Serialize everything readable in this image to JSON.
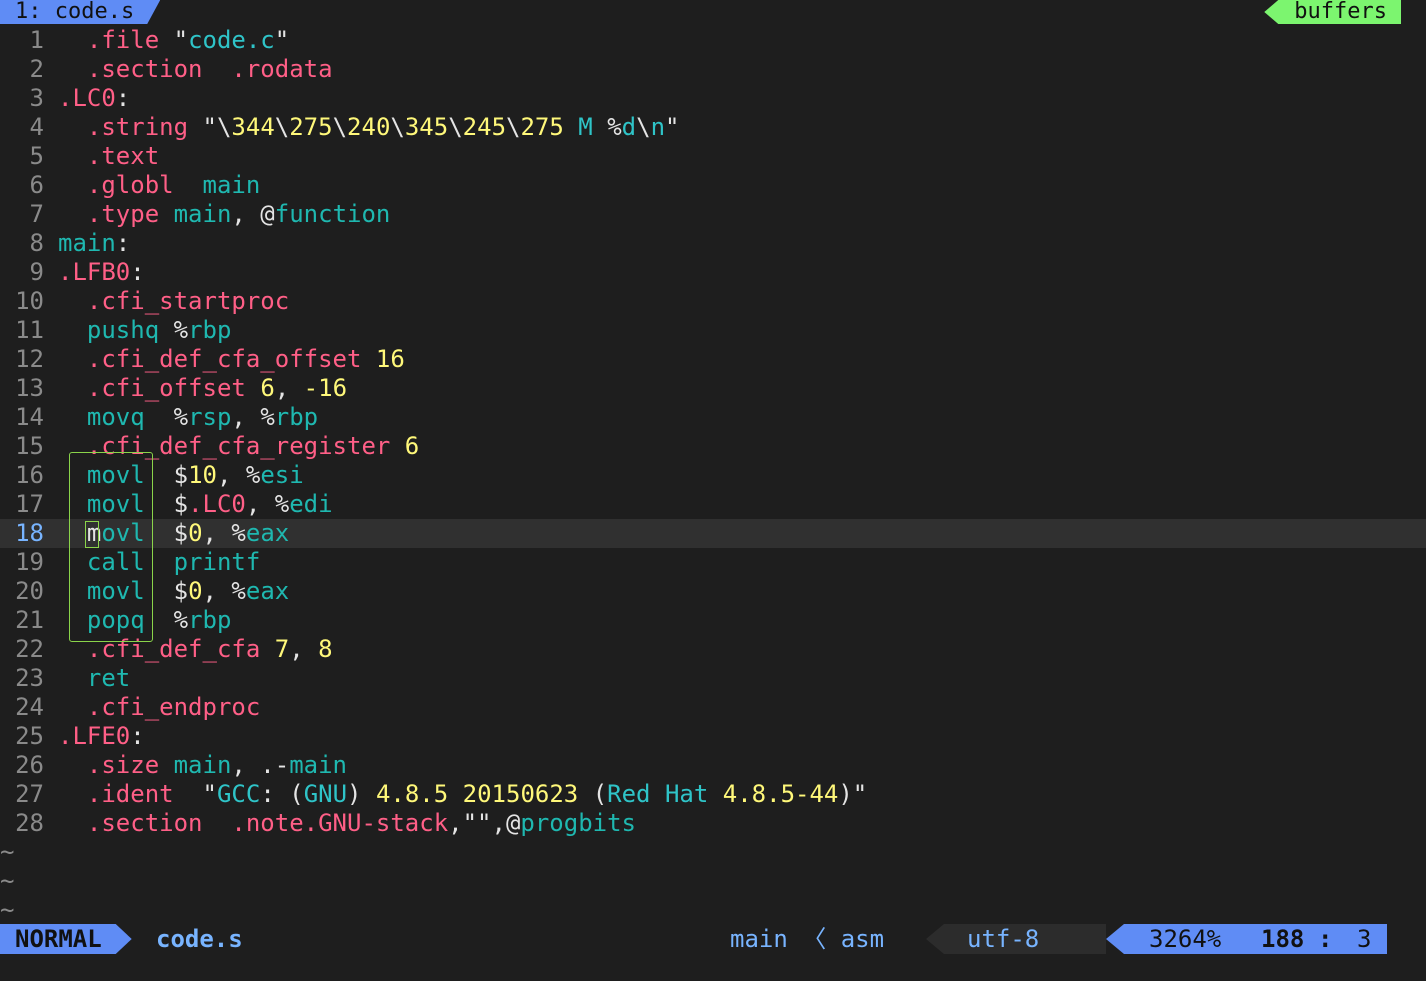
{
  "tabline": {
    "active_tab": "1: code.s",
    "right_label": "buffers"
  },
  "editor": {
    "current_line": 18,
    "lines": [
      {
        "n": "1",
        "tokens": [
          [
            "  ",
            "sym"
          ],
          [
            ".file",
            "dir"
          ],
          [
            " \"",
            "sym"
          ],
          [
            "code.c",
            "str"
          ],
          [
            "\"",
            "sym"
          ]
        ]
      },
      {
        "n": "2",
        "tokens": [
          [
            "  ",
            "sym"
          ],
          [
            ".section",
            "dir"
          ],
          [
            "  ",
            "sym"
          ],
          [
            ".rodata",
            "dir"
          ]
        ]
      },
      {
        "n": "3",
        "tokens": [
          [
            ".LC0",
            "dir"
          ],
          [
            ":",
            "sym"
          ]
        ]
      },
      {
        "n": "4",
        "tokens": [
          [
            "  ",
            "sym"
          ],
          [
            ".string",
            "dir"
          ],
          [
            " \"",
            "sym"
          ],
          [
            "\\",
            "sym"
          ],
          [
            "344",
            "num"
          ],
          [
            "\\",
            "sym"
          ],
          [
            "275",
            "num"
          ],
          [
            "\\",
            "sym"
          ],
          [
            "240",
            "num"
          ],
          [
            "\\",
            "sym"
          ],
          [
            "345",
            "num"
          ],
          [
            "\\",
            "sym"
          ],
          [
            "245",
            "num"
          ],
          [
            "\\",
            "sym"
          ],
          [
            "275",
            "num"
          ],
          [
            " M ",
            "str"
          ],
          [
            "%",
            "sym"
          ],
          [
            "d",
            "str"
          ],
          [
            "\\",
            "sym"
          ],
          [
            "n",
            "str"
          ],
          [
            "\"",
            "sym"
          ]
        ]
      },
      {
        "n": "5",
        "tokens": [
          [
            "  ",
            "sym"
          ],
          [
            ".text",
            "dir"
          ]
        ]
      },
      {
        "n": "6",
        "tokens": [
          [
            "  ",
            "sym"
          ],
          [
            ".globl",
            "dir"
          ],
          [
            "  ",
            "sym"
          ],
          [
            "main",
            "op"
          ]
        ]
      },
      {
        "n": "7",
        "tokens": [
          [
            "  ",
            "sym"
          ],
          [
            ".type",
            "dir"
          ],
          [
            " ",
            "sym"
          ],
          [
            "main",
            "op"
          ],
          [
            ", @",
            "sym"
          ],
          [
            "function",
            "op"
          ]
        ]
      },
      {
        "n": "8",
        "tokens": [
          [
            "main",
            "lbl"
          ],
          [
            ":",
            "sym"
          ]
        ]
      },
      {
        "n": "9",
        "tokens": [
          [
            ".LFB0",
            "dir"
          ],
          [
            ":",
            "sym"
          ]
        ]
      },
      {
        "n": "10",
        "tokens": [
          [
            "  ",
            "sym"
          ],
          [
            ".cfi_startproc",
            "dir"
          ]
        ]
      },
      {
        "n": "11",
        "tokens": [
          [
            "  ",
            "sym"
          ],
          [
            "pushq",
            "op"
          ],
          [
            " %",
            "sym"
          ],
          [
            "rbp",
            "reg"
          ]
        ]
      },
      {
        "n": "12",
        "tokens": [
          [
            "  ",
            "sym"
          ],
          [
            ".cfi_def_cfa_offset",
            "dir"
          ],
          [
            " ",
            "sym"
          ],
          [
            "16",
            "num"
          ]
        ]
      },
      {
        "n": "13",
        "tokens": [
          [
            "  ",
            "sym"
          ],
          [
            ".cfi_offset",
            "dir"
          ],
          [
            " ",
            "sym"
          ],
          [
            "6",
            "num"
          ],
          [
            ", ",
            "sym"
          ],
          [
            "-16",
            "num"
          ]
        ]
      },
      {
        "n": "14",
        "tokens": [
          [
            "  ",
            "sym"
          ],
          [
            "movq",
            "op"
          ],
          [
            "  %",
            "sym"
          ],
          [
            "rsp",
            "reg"
          ],
          [
            ", %",
            "sym"
          ],
          [
            "rbp",
            "reg"
          ]
        ]
      },
      {
        "n": "15",
        "tokens": [
          [
            "  ",
            "sym"
          ],
          [
            ".cfi_def_cfa_register",
            "dir"
          ],
          [
            " ",
            "sym"
          ],
          [
            "6",
            "num"
          ]
        ]
      },
      {
        "n": "16",
        "tokens": [
          [
            "  ",
            "sym"
          ],
          [
            "movl",
            "op"
          ],
          [
            "  $",
            "sym"
          ],
          [
            "10",
            "num"
          ],
          [
            ", %",
            "sym"
          ],
          [
            "esi",
            "reg"
          ]
        ]
      },
      {
        "n": "17",
        "tokens": [
          [
            "  ",
            "sym"
          ],
          [
            "movl",
            "op"
          ],
          [
            "  $",
            "sym"
          ],
          [
            ".LC0",
            "dir"
          ],
          [
            ", %",
            "sym"
          ],
          [
            "edi",
            "reg"
          ]
        ]
      },
      {
        "n": "18",
        "tokens": [
          [
            "  ",
            "sym"
          ],
          [
            "m",
            "sym"
          ],
          [
            "ovl",
            "op"
          ],
          [
            "  $",
            "sym"
          ],
          [
            "0",
            "num"
          ],
          [
            ", %",
            "sym"
          ],
          [
            "eax",
            "reg"
          ]
        ]
      },
      {
        "n": "19",
        "tokens": [
          [
            "  ",
            "sym"
          ],
          [
            "call",
            "op"
          ],
          [
            "  ",
            "sym"
          ],
          [
            "printf",
            "op"
          ]
        ]
      },
      {
        "n": "20",
        "tokens": [
          [
            "  ",
            "sym"
          ],
          [
            "movl",
            "op"
          ],
          [
            "  $",
            "sym"
          ],
          [
            "0",
            "num"
          ],
          [
            ", %",
            "sym"
          ],
          [
            "eax",
            "reg"
          ]
        ]
      },
      {
        "n": "21",
        "tokens": [
          [
            "  ",
            "sym"
          ],
          [
            "popq",
            "op"
          ],
          [
            "  %",
            "sym"
          ],
          [
            "rbp",
            "reg"
          ]
        ]
      },
      {
        "n": "22",
        "tokens": [
          [
            "  ",
            "sym"
          ],
          [
            ".cfi_def_cfa",
            "dir"
          ],
          [
            " ",
            "sym"
          ],
          [
            "7",
            "num"
          ],
          [
            ", ",
            "sym"
          ],
          [
            "8",
            "num"
          ]
        ]
      },
      {
        "n": "23",
        "tokens": [
          [
            "  ",
            "sym"
          ],
          [
            "ret",
            "op"
          ]
        ]
      },
      {
        "n": "24",
        "tokens": [
          [
            "  ",
            "sym"
          ],
          [
            ".cfi_endproc",
            "dir"
          ]
        ]
      },
      {
        "n": "25",
        "tokens": [
          [
            ".LFE0",
            "dir"
          ],
          [
            ":",
            "sym"
          ]
        ]
      },
      {
        "n": "26",
        "tokens": [
          [
            "  ",
            "sym"
          ],
          [
            ".size",
            "dir"
          ],
          [
            " ",
            "sym"
          ],
          [
            "main",
            "op"
          ],
          [
            ", .-",
            "sym"
          ],
          [
            "main",
            "op"
          ]
        ]
      },
      {
        "n": "27",
        "tokens": [
          [
            "  ",
            "sym"
          ],
          [
            ".ident",
            "dir"
          ],
          [
            "  \"",
            "sym"
          ],
          [
            "GCC",
            "str"
          ],
          [
            ": (",
            "sym"
          ],
          [
            "GNU",
            "str"
          ],
          [
            ") ",
            "sym"
          ],
          [
            "4.8.5",
            "num"
          ],
          [
            " ",
            "sym"
          ],
          [
            "20150623",
            "num"
          ],
          [
            " (",
            "sym"
          ],
          [
            "Red Hat",
            "str"
          ],
          [
            " ",
            "sym"
          ],
          [
            "4.8.5-44",
            "num"
          ],
          [
            ")\"",
            "sym"
          ]
        ]
      },
      {
        "n": "28",
        "tokens": [
          [
            "  ",
            "sym"
          ],
          [
            ".section",
            "dir"
          ],
          [
            "  ",
            "sym"
          ],
          [
            ".note.GNU-stack",
            "dir"
          ],
          [
            ",\"\",@",
            "sym"
          ],
          [
            "progbits",
            "op"
          ]
        ]
      }
    ],
    "tilde_lines": [
      "~",
      "~",
      "~"
    ]
  },
  "statusline": {
    "mode": "NORMAL",
    "filename": "code.s",
    "function_filetype": "main 〈 asm",
    "encoding": "utf-8",
    "percent": "3264%",
    "line": "188",
    "separator": ":",
    "column": "3"
  },
  "colors": {
    "background": "#1e1e1e",
    "directive": "#ff5f87",
    "opcode": "#1fb8b0",
    "number": "#fff87a",
    "string": "#2fc4c8",
    "mode_bg": "#5f8cf5",
    "buffers_bg": "#7cf56f",
    "selection_border": "#8ad44a"
  }
}
